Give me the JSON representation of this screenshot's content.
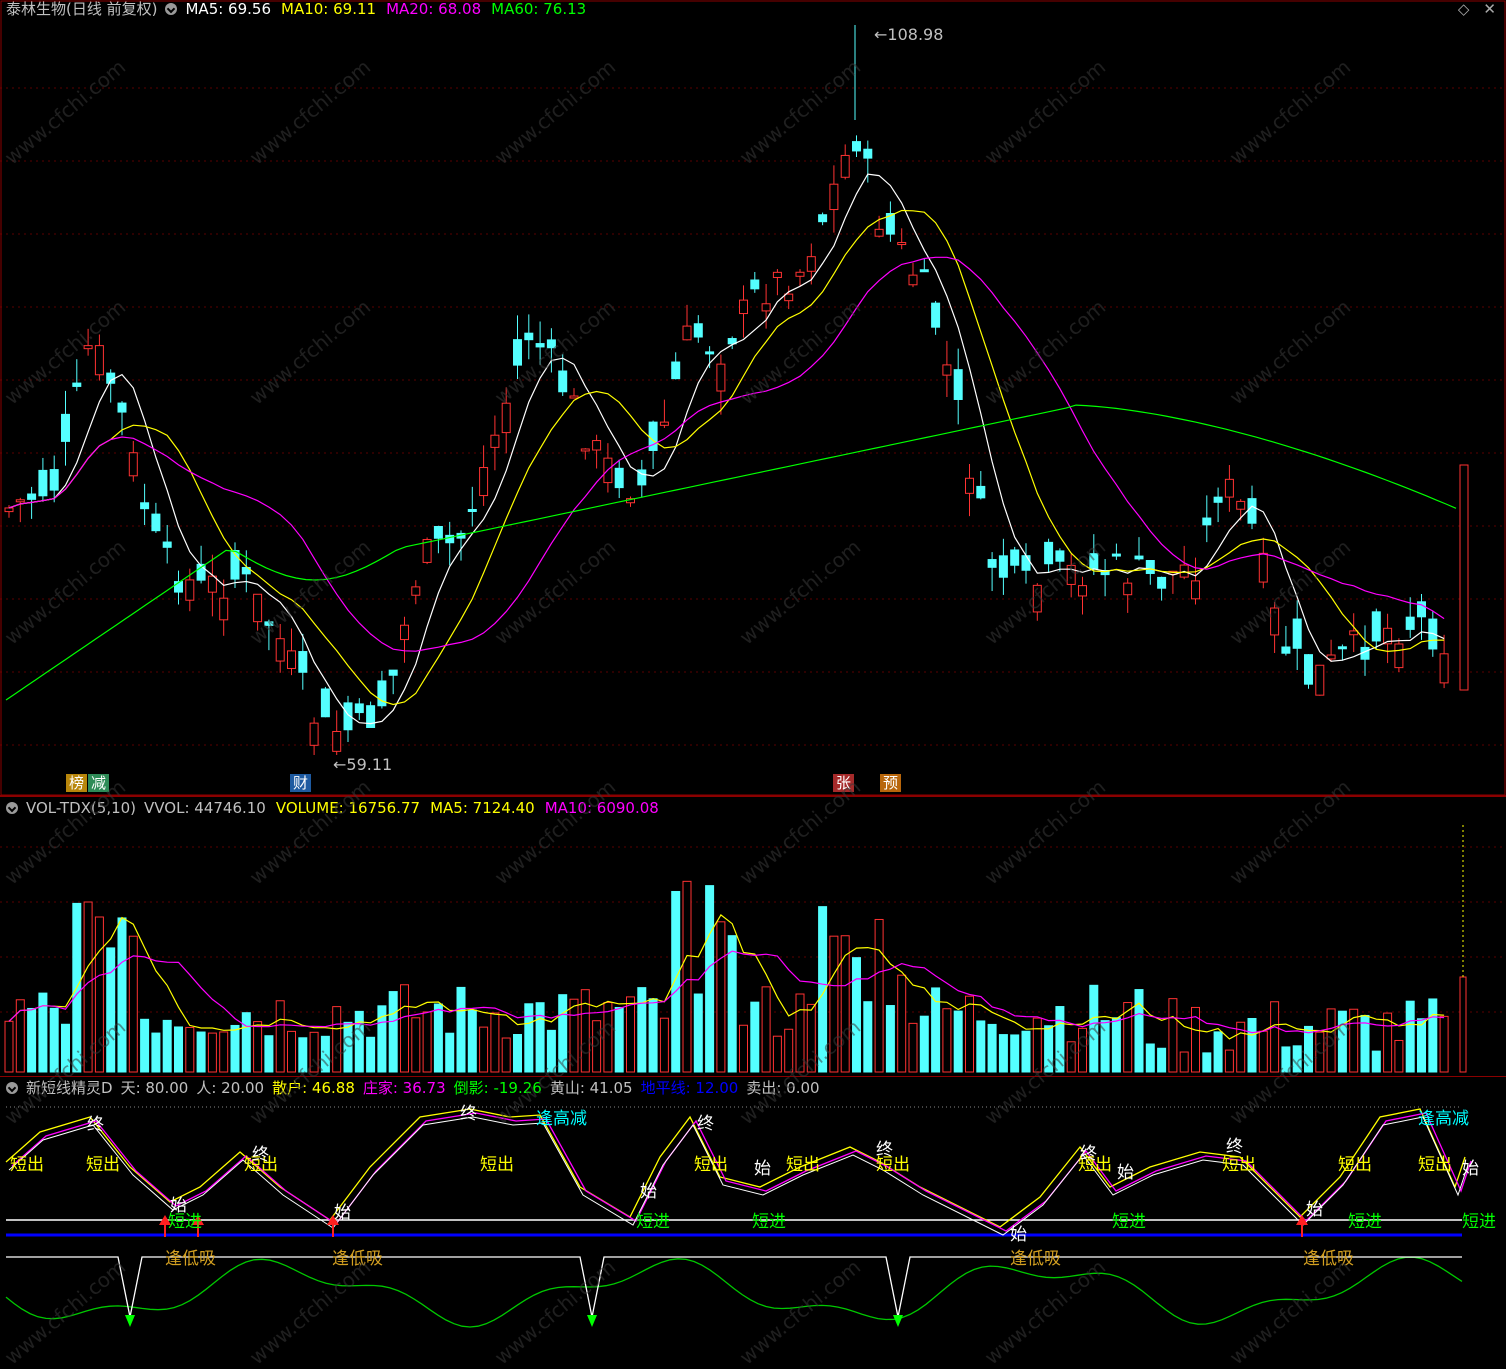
{
  "main": {
    "title": "泰林生物(日线 前复权)",
    "ma": [
      {
        "label": "MA5: 69.56",
        "color": "#ffffff"
      },
      {
        "label": "MA10: 69.11",
        "color": "#ffff00"
      },
      {
        "label": "MA20: 68.08",
        "color": "#ff00ff"
      },
      {
        "label": "MA60: 76.13",
        "color": "#00ff00"
      }
    ],
    "high_label": "108.98",
    "low_label": "59.11",
    "tags": [
      {
        "text": "榜",
        "color": "#b8860b"
      },
      {
        "text": "减",
        "color": "#2e8b57"
      },
      {
        "text": "财",
        "color": "#1e5aa0"
      },
      {
        "text": "张",
        "color": "#a52a2a"
      },
      {
        "text": "预",
        "color": "#b8660b"
      }
    ],
    "window_icons": [
      "diamond-icon",
      "close-icon"
    ]
  },
  "volume": {
    "title": "VOL-TDX(5,10)",
    "items": [
      {
        "label": "VVOL: 44746.10",
        "color": "#c0c0c0"
      },
      {
        "label": "VOLUME: 16756.77",
        "color": "#ffff00"
      },
      {
        "label": "MA5: 7124.40",
        "color": "#ffff00"
      },
      {
        "label": "MA10: 6090.08",
        "color": "#ff00ff"
      }
    ]
  },
  "indicator": {
    "title": "新短线精灵D",
    "items": [
      {
        "label": "天: 80.00",
        "color": "#c0c0c0"
      },
      {
        "label": "人: 20.00",
        "color": "#c0c0c0"
      },
      {
        "label": "散户: 46.88",
        "color": "#ffff00"
      },
      {
        "label": "庄家: 36.73",
        "color": "#ff00ff"
      },
      {
        "label": "倒影: -19.26",
        "color": "#00ff00"
      },
      {
        "label": "黄山: 41.05",
        "color": "#c0c0c0"
      },
      {
        "label": "地平线: 12.00",
        "color": "#0000ff"
      },
      {
        "label": "卖出: 0.00",
        "color": "#c0c0c0"
      }
    ],
    "words": {
      "short_out": "短出",
      "short_in": "短进",
      "low_buy": "逢低吸",
      "high_reduce": "逢高减",
      "start": "始",
      "end": "终"
    }
  },
  "watermark": "www.cfchi.com"
}
